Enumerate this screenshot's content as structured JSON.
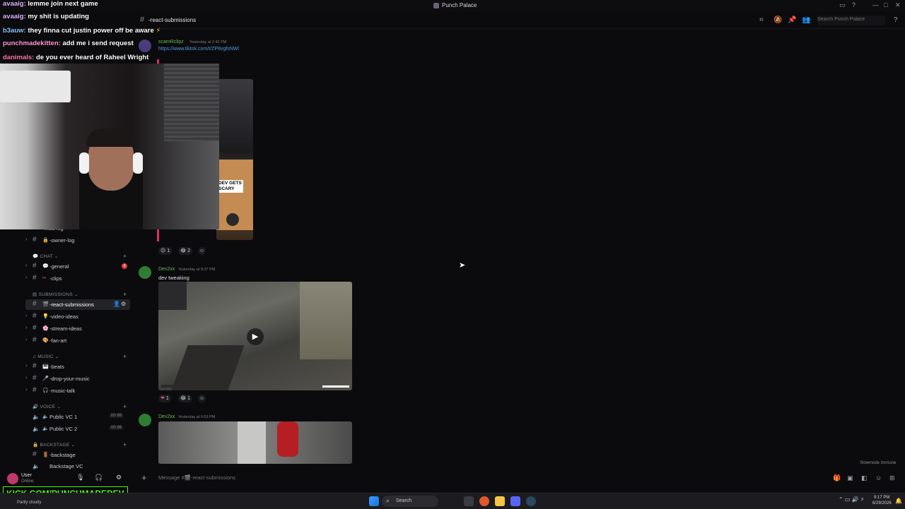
{
  "window": {
    "title": "Punch Palace",
    "buttons": [
      "—",
      "□",
      "✕"
    ]
  },
  "channel_header": {
    "channel": "-react-submissions",
    "search_placeholder": "Search Punch Palace"
  },
  "sidebar": {
    "items": [
      {
        "type": "channel",
        "emoji": "",
        "label": "-mod-log"
      },
      {
        "type": "channel",
        "emoji": "🔒",
        "label": "-owner-log"
      },
      {
        "type": "category",
        "label": "CHAT"
      },
      {
        "type": "channel",
        "emoji": "💬",
        "label": "-general",
        "badge": "4"
      },
      {
        "type": "channel",
        "emoji": "✂",
        "label": "-clips"
      },
      {
        "type": "category",
        "label": "SUBMISSIONS"
      },
      {
        "type": "channel",
        "emoji": "🎬",
        "label": "-react-submissions",
        "active": true
      },
      {
        "type": "channel",
        "emoji": "💡",
        "label": "-video-ideas"
      },
      {
        "type": "channel",
        "emoji": "🌸",
        "label": "-stream-ideas"
      },
      {
        "type": "channel",
        "emoji": "🎨",
        "label": "-fan-art"
      },
      {
        "type": "category",
        "label": "MUSIC"
      },
      {
        "type": "channel",
        "emoji": "🎹",
        "label": "-beats"
      },
      {
        "type": "channel",
        "emoji": "🎤",
        "label": "-drop-your-music"
      },
      {
        "type": "channel",
        "emoji": "🎧",
        "label": "-music-talk"
      },
      {
        "type": "category",
        "label": "VOICE"
      },
      {
        "type": "voice",
        "label": "Public VC 1",
        "counts": "00 99"
      },
      {
        "type": "voice",
        "label": "Public VC 2",
        "counts": "00 99"
      },
      {
        "type": "category",
        "label": "BACKSTAGE"
      },
      {
        "type": "channel",
        "emoji": "🚪",
        "label": "-backstage"
      },
      {
        "type": "channel",
        "emoji": "",
        "label": "Backstage VC"
      }
    ]
  },
  "messages": [
    {
      "author": "scamRclipz",
      "timestamp": "Yesterday at 2:42 PM",
      "link": "https://www.tiktok.com/t/ZP8vgfsNW/",
      "thumb_caption": "DEV GETS SCARY",
      "reactions": [
        {
          "emoji": "😐",
          "count": "1"
        },
        {
          "emoji": "😂",
          "count": "2"
        }
      ]
    },
    {
      "author": "Dev2xx",
      "timestamp": "Yesterday at 9:37 PM",
      "text": "dev tweaking",
      "reactions": [
        {
          "emoji": "❤",
          "count": "1"
        },
        {
          "emoji": "😂",
          "count": "1"
        }
      ]
    },
    {
      "author": "Dev2xx",
      "timestamp": "Yesterday at 9:53 PM"
    }
  ],
  "composer": {
    "placeholder": "Message #🎬-react-submissions"
  },
  "slowmode": "Slowmode Immune",
  "user_panel": {
    "name": "User",
    "status": "Online"
  },
  "chat_overlay": [
    {
      "user": "avaaig:",
      "text": "lemme join next game"
    },
    {
      "user": "avaaig:",
      "text": "my shit is updating"
    },
    {
      "user": "b3auw:",
      "text": "they finna cut justin power off be aware"
    },
    {
      "user": "punchmadekitten:",
      "text": "add me i send request"
    },
    {
      "user": "danimals:",
      "text": "de you ever heard of Raheel Wright"
    }
  ],
  "kick_banner": "KICK.COM/PUNCHMADEDEV",
  "taskbar": {
    "search_label": "Search",
    "weather": "Partly cloudy",
    "time": "9:17 PM",
    "date": "6/29/2026"
  },
  "colors": {
    "accent_green": "#5fbf5a",
    "kick_green": "#53fc18",
    "link_blue": "#4e9de6"
  }
}
